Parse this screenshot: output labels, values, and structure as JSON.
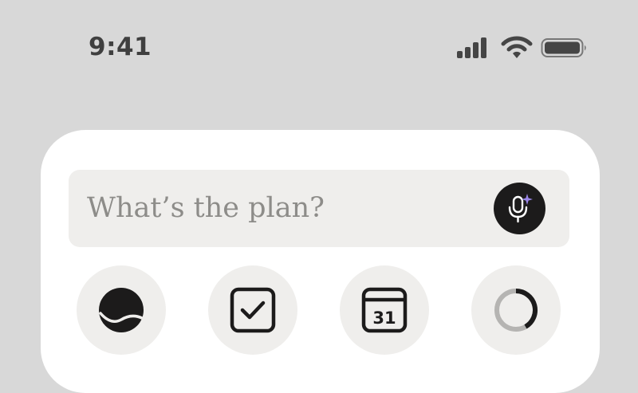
{
  "status_bar": {
    "time": "9:41",
    "icons": [
      "signal-bars-icon",
      "wifi-icon",
      "battery-icon"
    ]
  },
  "search": {
    "placeholder": "What’s the plan?",
    "voice_button_icon": "microphone-sparkle-icon"
  },
  "quick_actions": [
    {
      "icon": "smile-face-icon"
    },
    {
      "icon": "checkbox-icon"
    },
    {
      "icon": "calendar-icon",
      "day": "31"
    },
    {
      "icon": "progress-ring-icon"
    }
  ],
  "colors": {
    "background": "#d8d8d8",
    "card": "#ffffff",
    "field": "#efeeec",
    "icon_dark": "#1c1b1b",
    "sparkle_accent": "#9a86e8",
    "placeholder_text": "#8d8c89"
  }
}
